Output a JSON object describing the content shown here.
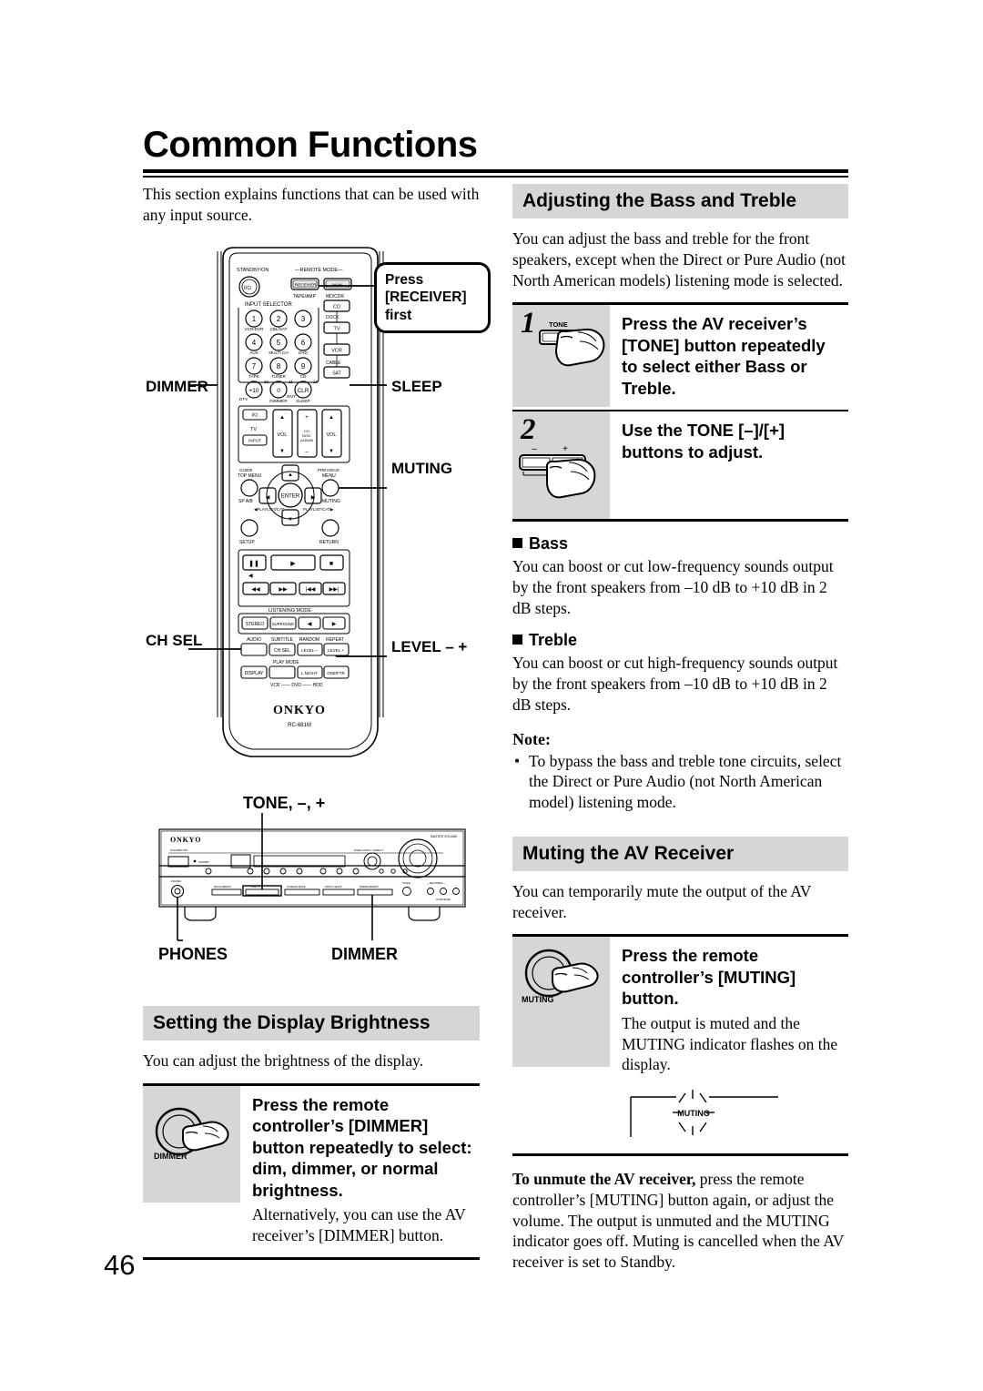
{
  "page": {
    "title": "Common Functions",
    "number": "46",
    "intro": "This section explains functions that can be used with any input source."
  },
  "remote_figure": {
    "model": "RC-681M",
    "brand": "ONKYO",
    "callout_bubble": "Press [RECEIVER] first",
    "callout_bubble_lines": [
      "Press",
      "[RECEIVER]",
      "first"
    ],
    "labels": {
      "dimmer": "DIMMER",
      "sleep": "SLEEP",
      "muting": "MUTING",
      "ch_sel": "CH SEL",
      "level": "LEVEL – +"
    },
    "keys": {
      "standby": "STANDBY/ON",
      "remote_mode": "REMOTE MODE",
      "receiver": "RECEIVER",
      "main": "MAIN",
      "tape_amp": "TAPE/AMP",
      "md_cdr": "MD/CDR",
      "cd": "CD",
      "dock": "DOCK",
      "tv": "TV",
      "vcr": "VCR",
      "cable": "CABLE",
      "sat": "SAT",
      "input_selector": "INPUT SELECTOR",
      "numbers": [
        "1",
        "2",
        "3",
        "4",
        "5",
        "6",
        "7",
        "8",
        "9",
        "0"
      ],
      "number_subs": [
        "VCR/DVR",
        "CBL/SAT",
        "",
        "AUX",
        "MULTI CH",
        "DVD",
        "TAPE",
        "TUNER",
        "CD"
      ],
      "plus10": "+10",
      "clr": "CLR",
      "ent": "ENT",
      "dtv": "DTV",
      "dimmer_sub": "DIMMER",
      "sleep_sub": "SLEEP",
      "tv_label": "TV",
      "input": "INPUT",
      "vol": "VOL",
      "ch_disc_album": "CH DISC ALBUM",
      "guide_top_menu": "GUIDE TOP MENU",
      "previous_menu": "PREVIOUS MENU",
      "sp_ab": "SP A/B",
      "enter": "ENTER",
      "playlist_cat_l": "◀PLAYLIST/CAT",
      "playlist_cat_r": "PLAYLIST/CAT▶",
      "setup": "SETUP",
      "return": "RETURN",
      "listening_mode": "LISTENING MODE",
      "stereo": "STEREO",
      "surround": "SURROUND",
      "audio": "AUDIO",
      "subtitle": "SUBTITLE",
      "random": "RANDOM",
      "repeat": "REPEAT",
      "ch_sel_key": "CH SEL",
      "level_minus": "LEVEL –",
      "level_plus": "LEVEL +",
      "play_mode": "PLAY MODE",
      "display": "DISPLAY",
      "l_night": "L NIGHT",
      "one_ftr": "ONE/FTR",
      "vcr_dvd_hdd": "VCR — DVD — HDD"
    }
  },
  "receiver_figure": {
    "brand": "ONKYO",
    "labels": {
      "tone": "TONE, –, +",
      "phones": "PHONES",
      "dimmer": "DIMMER"
    },
    "master_volume": "MASTER VOLUME"
  },
  "left_column": {
    "display_brightness": {
      "heading": "Setting the Display Brightness",
      "intro": "You can adjust the brightness of the display.",
      "step": {
        "figure_label": "DIMMER",
        "heading": "Press the remote controller’s [DIMMER] button repeatedly to select: dim, dimmer, or normal brightness.",
        "body": "Alternatively, you can use the AV receiver’s [DIMMER] button."
      }
    }
  },
  "right_column": {
    "bass_treble": {
      "heading": "Adjusting the Bass and Treble",
      "intro": "You can adjust the bass and treble for the front speakers, except when the Direct or Pure Audio (not North American models) listening mode is selected.",
      "steps": [
        {
          "number": "1",
          "figure_label": "TONE",
          "heading": "Press the AV receiver’s [TONE] button repeatedly to select either Bass or Treble."
        },
        {
          "number": "2",
          "figure_minus": "–",
          "figure_plus": "+",
          "heading": "Use the TONE [–]/[+] buttons to adjust."
        }
      ],
      "bass": {
        "heading": "Bass",
        "body": "You can boost or cut low-frequency sounds output by the front speakers from –10 dB to +10 dB in 2 dB steps."
      },
      "treble": {
        "heading": "Treble",
        "body": "You can boost or cut high-frequency sounds output by the front speakers from –10 dB to +10 dB in 2 dB steps."
      },
      "note": {
        "heading": "Note:",
        "items": [
          "To bypass the bass and treble tone circuits, select the Direct or Pure Audio (not North American model) listening mode."
        ]
      }
    },
    "muting": {
      "heading": "Muting the AV Receiver",
      "intro": "You can temporarily mute the output of the AV receiver.",
      "step": {
        "figure_label": "MUTING",
        "heading": "Press the remote controller’s [MUTING] button.",
        "body": "The output is muted and the MUTING indicator flashes on the display.",
        "display_indicator": "MUTING"
      },
      "unmute_bold": "To unmute the AV receiver,",
      "unmute_rest": " press the remote controller’s [MUTING] button again, or adjust the volume. The output is unmuted and the MUTING indicator goes off. Muting is cancelled when the AV receiver is set to Standby."
    }
  },
  "colors": {
    "header_gray": "#d6d6d6",
    "figure_gray": "#d6d6d6",
    "ink": "#000000"
  }
}
